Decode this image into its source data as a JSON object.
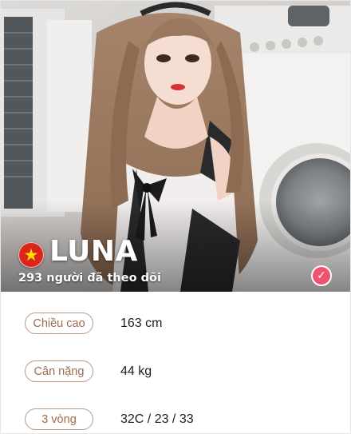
{
  "profile": {
    "name": "LUNA",
    "flag_icon": "vietnam-flag-icon",
    "follower_count": "293",
    "follower_text": "người đã theo dõi",
    "verified_icon": "check-icon",
    "accent_color": "#f0516f"
  },
  "stats": [
    {
      "label": "Chiều cao",
      "value": "163 cm"
    },
    {
      "label": "Cân nặng",
      "value": "44 kg"
    },
    {
      "label": "3 vòng",
      "value": "32C / 23 / 33"
    }
  ],
  "colors": {
    "label_border": "#b99a82",
    "label_text": "#9b6c4c",
    "value_text": "#1e1e1e"
  }
}
